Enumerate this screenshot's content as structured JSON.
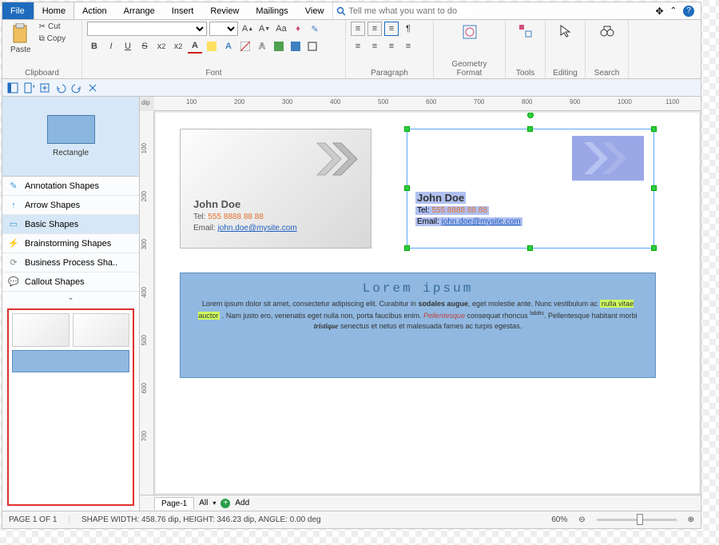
{
  "tabs": {
    "file": "File",
    "home": "Home",
    "action": "Action",
    "arrange": "Arrange",
    "insert": "Insert",
    "review": "Review",
    "mailings": "Mailings",
    "view": "View"
  },
  "tellme_placeholder": "Tell me what you want to do",
  "ribbon": {
    "clipboard": {
      "label": "Clipboard",
      "paste": "Paste",
      "cut": "Cut",
      "copy": "Copy"
    },
    "font": {
      "label": "Font"
    },
    "paragraph": {
      "label": "Paragraph"
    },
    "geometry": "Geometry Format",
    "tools": "Tools",
    "editing": "Editing",
    "search": "Search"
  },
  "ruler_unit": "dip",
  "side": {
    "preview_label": "Rectangle",
    "cats": [
      {
        "label": "Annotation Shapes",
        "color": "#3a9ad9"
      },
      {
        "label": "Arrow Shapes",
        "color": "#3a9ad9"
      },
      {
        "label": "Basic Shapes",
        "color": "#3a9ad9",
        "selected": true
      },
      {
        "label": "Brainstorming Shapes",
        "color": "#e06030"
      },
      {
        "label": "Business Process Sha..",
        "color": "#888"
      },
      {
        "label": "Callout Shapes",
        "color": "#3a9ad9"
      }
    ]
  },
  "card1": {
    "name": "John Doe",
    "tel_label": "Tel:",
    "tel": "555 8888 88 88",
    "email_label": "Email:",
    "email": "john.doe@mysite.com"
  },
  "card2": {
    "name": "John Doe",
    "tel_label": "Tel:",
    "tel": "555 8888 88 88",
    "email_label": "Email:",
    "email": "john.doe@mysite.com"
  },
  "lorem": {
    "title": "Lorem ipsum",
    "p1a": "Lorem ipsum dolor sit amet, consectetur adipiscing elit. Curabitur in ",
    "p1b": "sodales augue",
    "p1c": ", eget molestie ante. Nunc vestibulum ac ",
    "hl": "nulla vitae auctor",
    "p1d": " . Nam justo ero, venenatis eget nulla non, porta faucibus enim. ",
    "red": "Pellentesque",
    "p2a": " consequat rhoncus ",
    "sup": "labitis",
    "p2b": ". Pellentesque habitant morbi ",
    "cur": "tristique",
    "p2c": " senectus et netus et malesuada fames ac turpis egestas."
  },
  "pagetabs": {
    "page1": "Page-1",
    "all": "All",
    "add": "Add"
  },
  "status": {
    "pages": "PAGE 1 OF 1",
    "shape": "SHAPE WIDTH: 458.76 dip, HEIGHT: 346.23 dip, ANGLE: 0.00 deg",
    "zoom": "60%"
  },
  "ruler_h": [
    "100",
    "200",
    "300",
    "400",
    "500",
    "600",
    "700",
    "800",
    "900",
    "1000",
    "1100"
  ],
  "ruler_v": [
    "100",
    "200",
    "300",
    "400",
    "500",
    "600",
    "700"
  ]
}
